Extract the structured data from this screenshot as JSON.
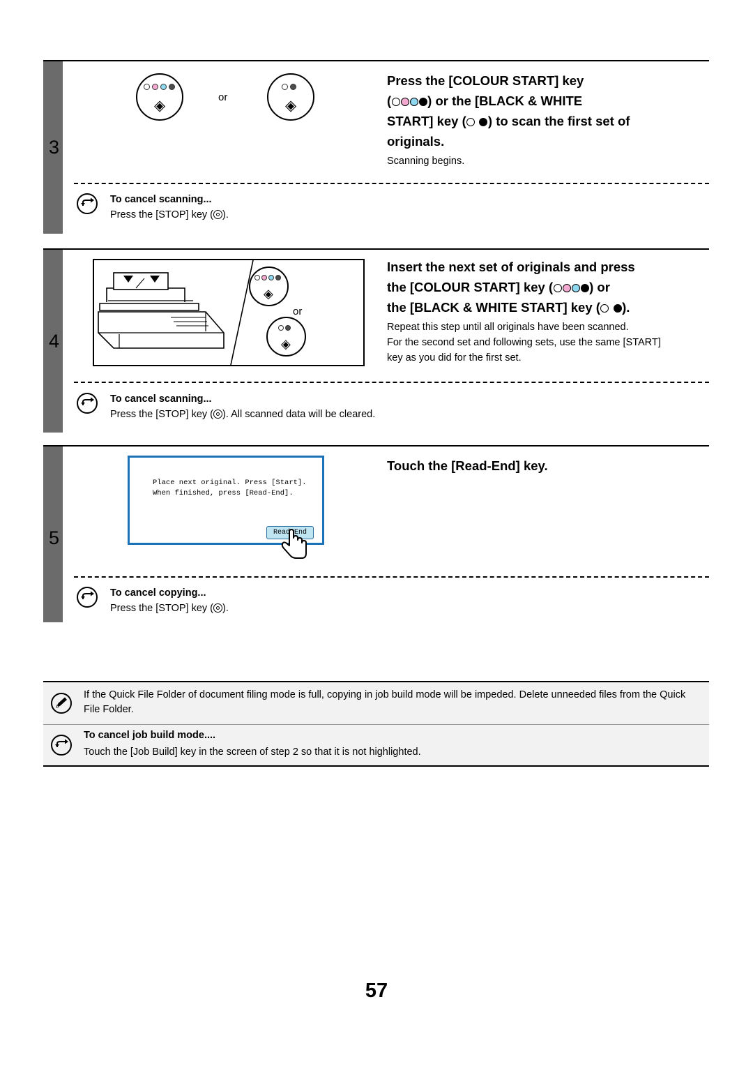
{
  "page": {
    "number": "57"
  },
  "steps": [
    {
      "number": "3",
      "heading_lines": [
        "Press the [COLOUR START] key",
        "(○○○●) or the [BLACK & WHITE",
        "START] key (○ ●) to scan the first set of",
        "originals."
      ],
      "body": "Scanning begins.",
      "cancel_title": "To cancel scanning...",
      "cancel_body": "Press the [STOP] key (   ).",
      "or_label": "or"
    },
    {
      "number": "4",
      "heading_lines": [
        "Insert the next set of originals and press",
        "the [COLOUR START] key (○○○●) or",
        "the [BLACK & WHITE START] key (○ ●)."
      ],
      "body_lines": [
        "Repeat this step until all originals have been scanned.",
        "For the second set and following sets, use the same [START]",
        "key as you did for the first set."
      ],
      "cancel_title": "To cancel scanning...",
      "cancel_body": "Press the [STOP] key (   ). All scanned data will be cleared.",
      "or_label": "or"
    },
    {
      "number": "5",
      "heading_lines": [
        "Touch the [Read-End] key."
      ],
      "lcd": {
        "line1": "Place next original. Press [Start].",
        "line2": "When finished, press [Read-End].",
        "button": "Read-End"
      },
      "cancel_title": "To cancel copying...",
      "cancel_body": "Press the [STOP] key (   )."
    }
  ],
  "note": {
    "memo_text": "If the Quick File Folder of document filing mode is full, copying in job build mode will be impeded. Delete unneeded files from the Quick File Folder.",
    "cancel_title": "To cancel job build mode....",
    "cancel_body": "Touch the [Job Build] key in the screen of step 2 so that it is not highlighted."
  },
  "colors": {
    "step_bar": "#6b6b6b",
    "lcd_border": "#1a72b8",
    "lcd_button": "#bfe4f2",
    "note_bg": "#f2f2f2"
  }
}
